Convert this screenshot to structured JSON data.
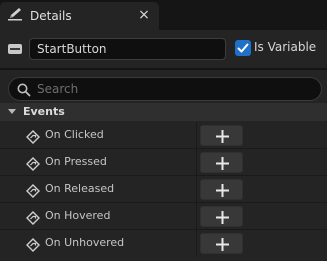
{
  "tab": {
    "title": "Details",
    "icon": "pencil-icon",
    "close_glyph": "×"
  },
  "widget": {
    "name": "StartButton",
    "is_variable_label": "Is Variable",
    "is_variable_checked": true
  },
  "search": {
    "placeholder": "Search"
  },
  "events": {
    "header": "Events",
    "items": [
      {
        "label": "On Clicked"
      },
      {
        "label": "On Pressed"
      },
      {
        "label": "On Released"
      },
      {
        "label": "On Hovered"
      },
      {
        "label": "On Unhovered"
      }
    ]
  },
  "colors": {
    "accent": "#1e70c9",
    "panel_bg": "#242424",
    "input_bg": "#0f0f0f"
  }
}
